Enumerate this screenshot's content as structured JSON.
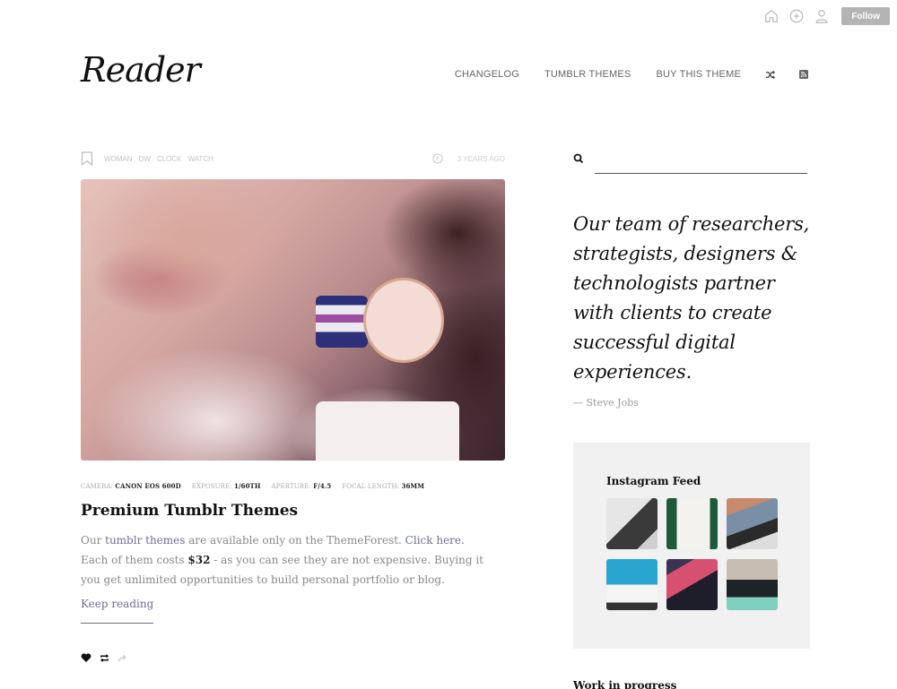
{
  "tumblr_bar": {
    "icons": [
      "home-icon",
      "compose-icon",
      "account-icon"
    ],
    "follow_label": "Follow"
  },
  "header": {
    "logo": "Reader",
    "nav": [
      {
        "label": "CHANGELOG"
      },
      {
        "label": "TUMBLR THEMES"
      },
      {
        "label": "BUY THIS THEME"
      }
    ],
    "nav_icons": [
      "shuffle-icon",
      "rss-icon"
    ]
  },
  "post": {
    "tags": [
      "WOMAN",
      "DW",
      "CLOCK",
      "WATCH"
    ],
    "time_ago": "3 YEARS AGO",
    "exif": [
      {
        "label": "CAMERA:",
        "value": "CANON EOS 600D"
      },
      {
        "label": "EXPOSURE:",
        "value": "1/60TH"
      },
      {
        "label": "APERTURE:",
        "value": "F/4.5"
      },
      {
        "label": "FOCAL LENGTH:",
        "value": "36MM"
      }
    ],
    "title": "Premium Tumblr Themes",
    "body": {
      "p1_before": "Our ",
      "p1_link": "tumblr themes",
      "p1_middle": " are available only on the ThemeForest. ",
      "p1_link2": "Click here.",
      "p2_before": "Each of them costs ",
      "p2_price": "$32",
      "p2_after": " - as you can see they are not expensive. Buying it you get unlimited opportunities to build personal portfolio or blog."
    },
    "keep_reading": "Keep reading",
    "actions": [
      "like-icon",
      "reblog-icon",
      "share-icon"
    ]
  },
  "sidebar": {
    "search": {
      "placeholder": "",
      "value": ""
    },
    "quote": "Our team of researchers, strategists, designers & technologists partner with clients to create successful digital experiences.",
    "quote_author": "— Steve Jobs",
    "instagram": {
      "title": "Instagram Feed",
      "count": 6
    },
    "next_section": "Work in progress"
  },
  "colors": {
    "accent_link": "#6a6f93",
    "follow_bg": "#b4b4b4",
    "widget_bg": "#f1f1f1"
  }
}
